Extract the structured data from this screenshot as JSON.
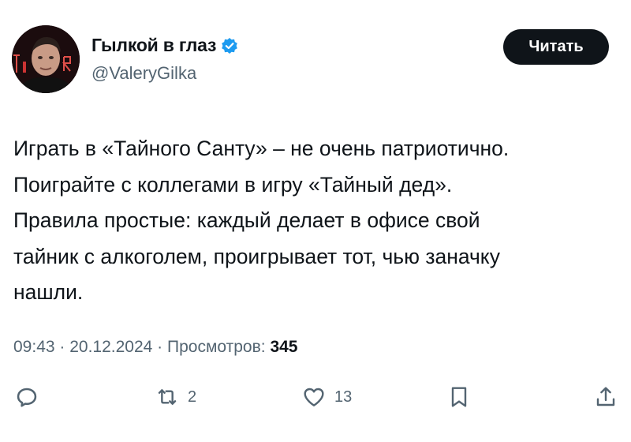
{
  "author": {
    "name": "Гылкой в глаз",
    "handle": "@ValeryGilka",
    "verified": true,
    "verified_color": "#1d9bf0"
  },
  "follow_button": {
    "label": "Читать"
  },
  "tweet": {
    "lines": [
      "Играть в «Тайного Санту» – не очень патриотично.",
      "Поиграйте с коллегами в игру «Тайный дед».",
      "Правила простые: каждый делает в офисе свой",
      "тайник с алкоголем, проигрывает тот, чью заначку",
      "нашли."
    ]
  },
  "meta": {
    "time": "09:43",
    "separator": " · ",
    "date": "20.12.2024",
    "views_label": "Просмотров:",
    "views_count": "345"
  },
  "actions": {
    "reply": {
      "icon": "reply-icon",
      "count": ""
    },
    "retweet": {
      "icon": "retweet-icon",
      "count": "2"
    },
    "like": {
      "icon": "heart-icon",
      "count": "13"
    },
    "bookmark": {
      "icon": "bookmark-icon",
      "count": ""
    },
    "share": {
      "icon": "share-icon",
      "count": ""
    }
  }
}
